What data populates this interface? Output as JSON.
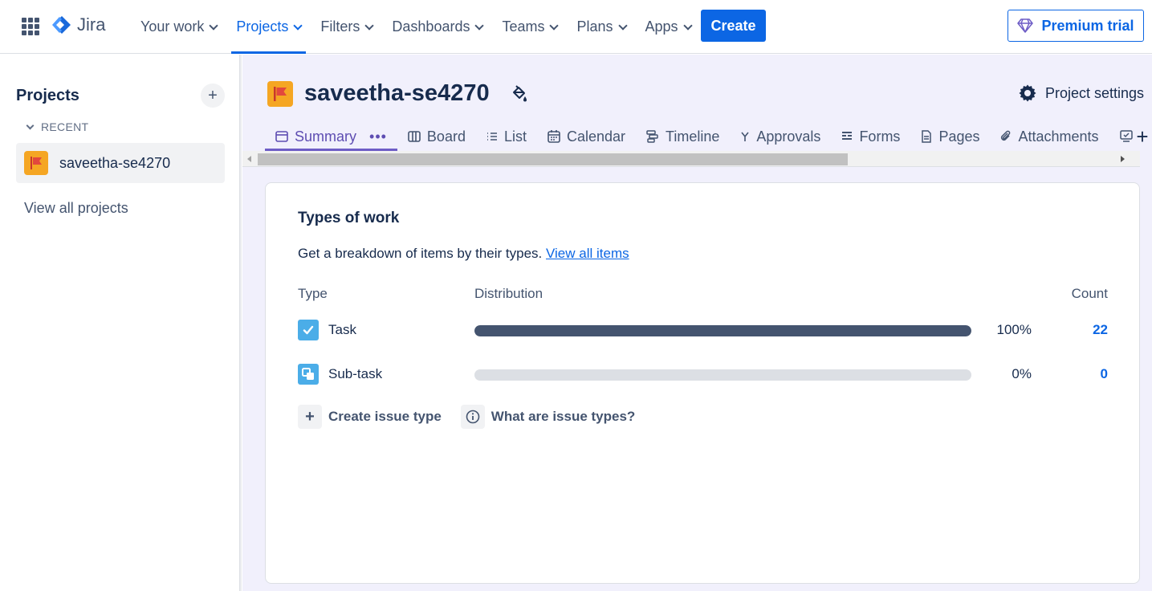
{
  "topnav": {
    "logo_text": "Jira",
    "items": [
      {
        "label": "Your work"
      },
      {
        "label": "Projects"
      },
      {
        "label": "Filters"
      },
      {
        "label": "Dashboards"
      },
      {
        "label": "Teams"
      },
      {
        "label": "Plans"
      },
      {
        "label": "Apps"
      }
    ],
    "active_item": "Projects",
    "create_label": "Create",
    "premium_label": "Premium trial"
  },
  "sidebar": {
    "title": "Projects",
    "add_icon": "plus-icon",
    "recent_label": "RECENT",
    "recent_project": "saveetha-se4270",
    "view_all": "View all projects"
  },
  "project": {
    "name": "saveetha-se4270",
    "settings_label": "Project settings",
    "tabs": [
      {
        "label": "Summary",
        "icon": "summary-icon"
      },
      {
        "label": "Board",
        "icon": "board-icon"
      },
      {
        "label": "List",
        "icon": "list-icon"
      },
      {
        "label": "Calendar",
        "icon": "calendar-icon"
      },
      {
        "label": "Timeline",
        "icon": "timeline-icon"
      },
      {
        "label": "Approvals",
        "icon": "approvals-icon"
      },
      {
        "label": "Forms",
        "icon": "forms-icon"
      },
      {
        "label": "Pages",
        "icon": "pages-icon"
      },
      {
        "label": "Attachments",
        "icon": "attachments-icon"
      }
    ],
    "active_tab": "Summary",
    "more_label": "•••"
  },
  "card": {
    "title": "Types of work",
    "description": "Get a breakdown of items by their types.",
    "link": "View all items",
    "columns": {
      "type": "Type",
      "distribution": "Distribution",
      "count": "Count"
    },
    "rows": [
      {
        "type": "Task",
        "percent_label": "100%",
        "percent": 100,
        "count": "22",
        "icon": "task-icon"
      },
      {
        "type": "Sub-task",
        "percent_label": "0%",
        "percent": 0,
        "count": "0",
        "icon": "subtask-icon"
      }
    ],
    "actions": {
      "create_issue_type": "Create issue type",
      "what_are_issue_types": "What are issue types?"
    }
  },
  "colors": {
    "accent": "#0c66e4",
    "tab_active": "#5e4db2",
    "bar_fill": "#44546f",
    "bar_bg": "#dcdfe4",
    "main_bg": "#f1f0fc"
  }
}
